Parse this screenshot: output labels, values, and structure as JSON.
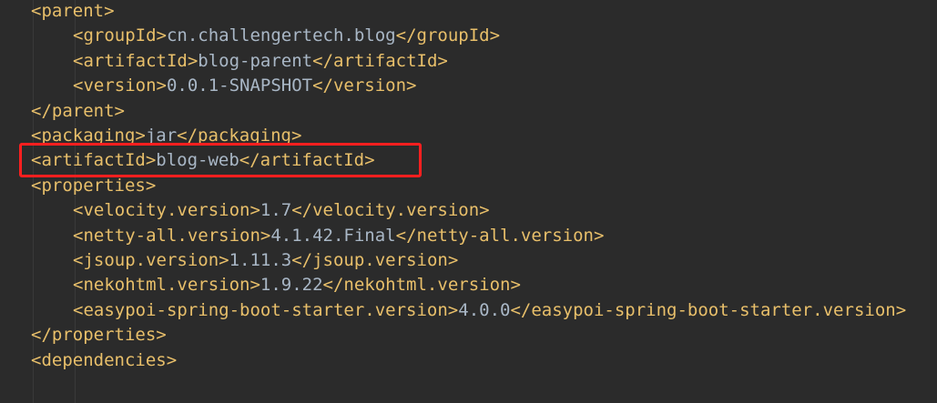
{
  "editor": {
    "lines": [
      {
        "indent": 0,
        "open": "<parent>",
        "value": "",
        "close": ""
      },
      {
        "indent": 1,
        "open": "<groupId>",
        "value": "cn.challengertech.blog",
        "close": "</groupId>"
      },
      {
        "indent": 1,
        "open": "<artifactId>",
        "value": "blog-parent",
        "close": "</artifactId>"
      },
      {
        "indent": 1,
        "open": "<version>",
        "value": "0.0.1-SNAPSHOT",
        "close": "</version>"
      },
      {
        "indent": 0,
        "open": "</parent>",
        "value": "",
        "close": ""
      },
      {
        "indent": 0,
        "open": "<packaging>",
        "value": "jar",
        "close": "</packaging>"
      },
      {
        "indent": 0,
        "open": "<artifactId>",
        "value": "blog-web",
        "close": "</artifactId>"
      },
      {
        "indent": 0,
        "open": "<properties>",
        "value": "",
        "close": ""
      },
      {
        "indent": 1,
        "open": "<velocity.version>",
        "value": "1.7",
        "close": "</velocity.version>"
      },
      {
        "indent": 1,
        "open": "<netty-all.version>",
        "value": "4.1.42.Final",
        "close": "</netty-all.version>"
      },
      {
        "indent": 1,
        "open": "<jsoup.version>",
        "value": "1.11.3",
        "close": "</jsoup.version>"
      },
      {
        "indent": 1,
        "open": "<nekohtml.version>",
        "value": "1.9.22",
        "close": "</nekohtml.version>"
      },
      {
        "indent": 1,
        "open": "<easypoi-spring-boot-starter.version>",
        "value": "4.0.0",
        "close": "</easypoi-spring-boot-starter.version>"
      },
      {
        "indent": 0,
        "open": "</properties>",
        "value": "",
        "close": ""
      },
      {
        "indent": 0,
        "open": "<dependencies>",
        "value": "",
        "close": ""
      }
    ],
    "highlighted_line": 6,
    "colors": {
      "background": "#2b2b2b",
      "tag": "#e8bf6a",
      "text": "#a9b7c6",
      "highlight": "#ff1f1f"
    }
  }
}
